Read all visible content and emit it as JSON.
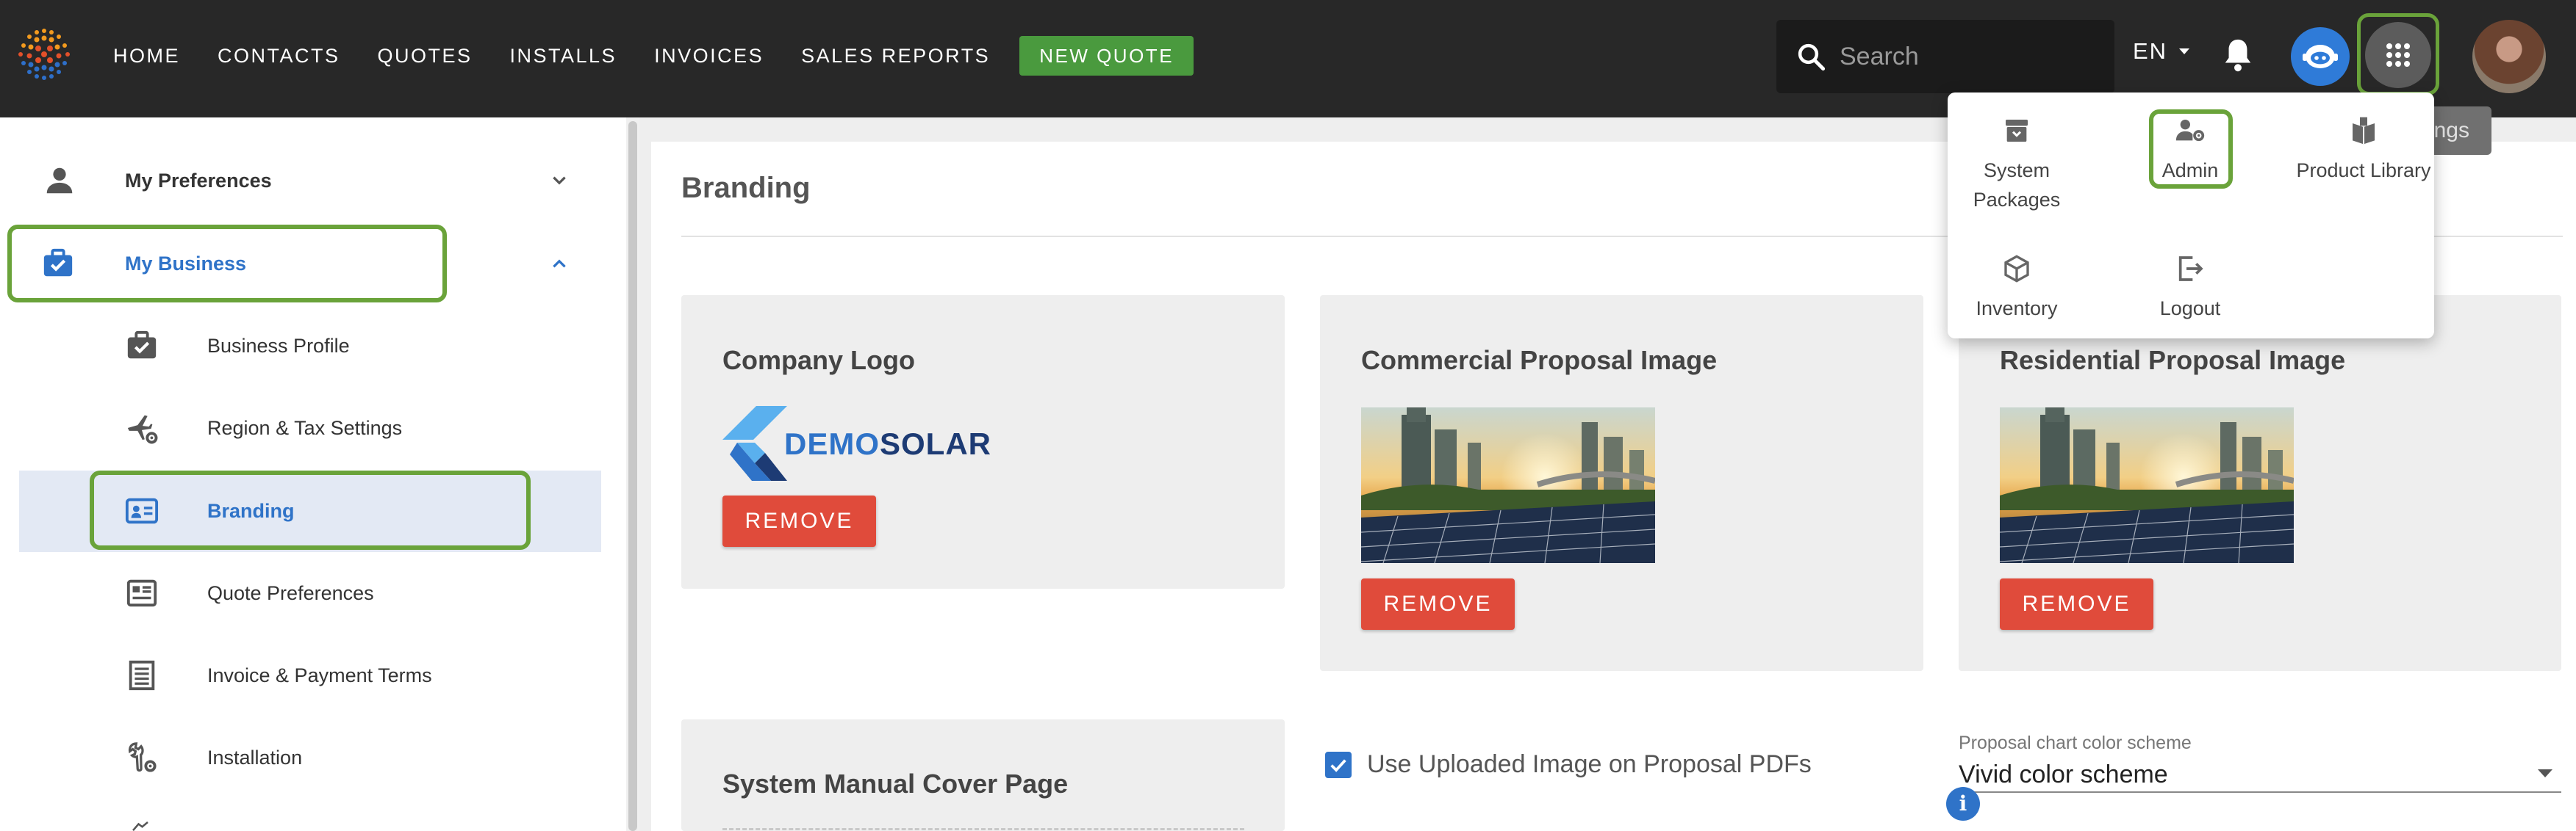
{
  "nav": {
    "links": [
      "HOME",
      "CONTACTS",
      "QUOTES",
      "INSTALLS",
      "INVOICES",
      "SALES REPORTS"
    ],
    "new_quote": "NEW QUOTE",
    "search_placeholder": "Search",
    "language": "EN"
  },
  "apps_menu": {
    "tooltip": "ngs",
    "items": {
      "system_packages": "System Packages",
      "admin": "Admin",
      "product_library": "Product Library",
      "inventory": "Inventory",
      "logout": "Logout"
    }
  },
  "sidebar": {
    "preferences": "My Preferences",
    "business": "My Business",
    "items": [
      "Business Profile",
      "Region & Tax Settings",
      "Branding",
      "Quote Preferences",
      "Invoice & Payment Terms",
      "Installation"
    ]
  },
  "main": {
    "title": "Branding",
    "company_logo": {
      "title": "Company Logo",
      "logo_text_a": "DEMO",
      "logo_text_b": "SOLAR",
      "remove": "REMOVE"
    },
    "commercial": {
      "title": "Commercial Proposal Image",
      "remove": "REMOVE"
    },
    "residential": {
      "title": "Residential Proposal Image",
      "remove": "REMOVE"
    },
    "manual_cover": {
      "title": "System Manual Cover Page"
    },
    "use_uploaded_label": "Use Uploaded Image on Proposal PDFs",
    "use_uploaded_checked": true,
    "chart_scheme": {
      "label": "Proposal chart color scheme",
      "value": "Vivid color scheme"
    }
  },
  "colors": {
    "accent_green": "#4a9a3e",
    "highlight_green": "#6aa33a",
    "remove_red": "#e04b3b",
    "primary_blue": "#2f73c8"
  }
}
